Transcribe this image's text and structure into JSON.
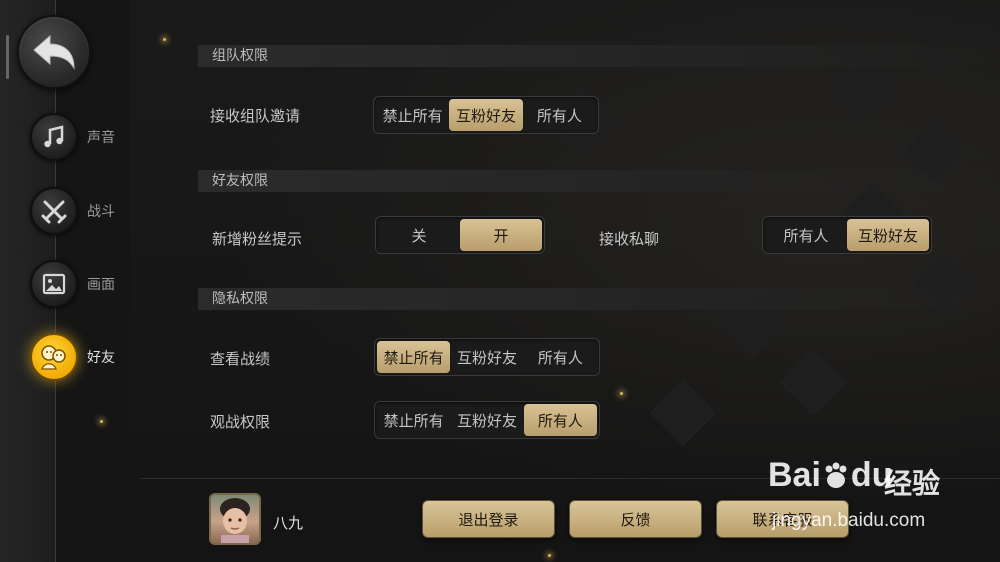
{
  "sidebar": {
    "back_icon": "back-arrow-icon",
    "items": [
      {
        "label": "声音",
        "icon": "music-note-icon",
        "active": false
      },
      {
        "label": "战斗",
        "icon": "crossed-swords-icon",
        "active": false
      },
      {
        "label": "画面",
        "icon": "picture-icon",
        "active": false
      },
      {
        "label": "好友",
        "icon": "friends-icon",
        "active": true
      }
    ]
  },
  "sections": {
    "team": {
      "title": "组队权限",
      "invite": {
        "label": "接收组队邀请",
        "options": [
          "禁止所有",
          "互粉好友",
          "所有人"
        ],
        "selected": 1
      }
    },
    "friend": {
      "title": "好友权限",
      "new_fan": {
        "label": "新增粉丝提示",
        "options": [
          "关",
          "开"
        ],
        "selected": 1
      },
      "private_msg": {
        "label": "接收私聊",
        "options": [
          "所有人",
          "互粉好友"
        ],
        "selected": 1
      }
    },
    "privacy": {
      "title": "隐私权限",
      "record": {
        "label": "查看战绩",
        "options": [
          "禁止所有",
          "互粉好友",
          "所有人"
        ],
        "selected": 0
      },
      "spectate": {
        "label": "观战权限",
        "options": [
          "禁止所有",
          "互粉好友",
          "所有人"
        ],
        "selected": 2
      }
    }
  },
  "footer": {
    "username": "八九",
    "logout_label": "退出登录",
    "feedback_label": "反馈",
    "contact_label": "联系客服"
  },
  "watermark": {
    "logo": "Bai",
    "logo_suffix": "du",
    "cn": "经验",
    "url": "jingyan.baidu.com"
  },
  "colors": {
    "accent_gold": "#c9b081",
    "active_yellow": "#f6c21a",
    "background": "#151515"
  }
}
